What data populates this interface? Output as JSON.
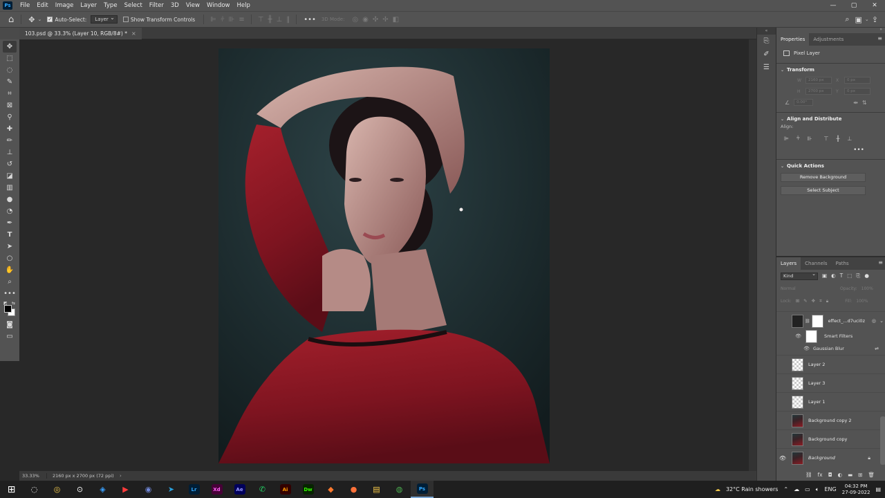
{
  "app": {
    "logo": "Ps"
  },
  "menu": [
    "File",
    "Edit",
    "Image",
    "Layer",
    "Type",
    "Select",
    "Filter",
    "3D",
    "View",
    "Window",
    "Help"
  ],
  "window_controls": {
    "minimize": "—",
    "maximize": "▢",
    "close": "✕"
  },
  "options_bar": {
    "auto_select_label": "Auto-Select:",
    "auto_select_checked": true,
    "auto_select_target": "Layer",
    "show_transform_label": "Show Transform Controls",
    "show_transform_checked": false,
    "mode_3d_label": "3D Mode:"
  },
  "document": {
    "tab_title": "103.psd @ 33.3% (Layer 10, RGB/8#) *",
    "tab_close": "×",
    "zoom": "33.33%",
    "info": "2160 px x 2700 px (72 ppi)",
    "status_arrow": "›"
  },
  "tools": [
    "move-tool",
    "marquee-tool",
    "lasso-tool",
    "quick-select-tool",
    "crop-tool",
    "frame-tool",
    "eyedropper-tool",
    "healing-brush-tool",
    "brush-tool",
    "clone-stamp-tool",
    "history-brush-tool",
    "eraser-tool",
    "gradient-tool",
    "blur-tool",
    "dodge-tool",
    "pen-tool",
    "type-tool",
    "path-select-tool",
    "shape-tool",
    "hand-tool",
    "zoom-tool",
    "edit-toolbar"
  ],
  "colors": {
    "foreground": "#000000",
    "background": "#ffffff",
    "accent": "#31a8ff"
  },
  "dock": {
    "collapse": "«"
  },
  "panel_collapse": "»",
  "properties": {
    "tabs": [
      "Properties",
      "Adjustments"
    ],
    "active_tab": 0,
    "menu_icon": "≡",
    "layer_kind": "Pixel Layer",
    "transform": {
      "title": "Transform",
      "w_label": "W",
      "w_value": "2160 px",
      "h_label": "H",
      "h_value": "2700 px",
      "x_label": "X",
      "x_value": "0 px",
      "y_label": "Y",
      "y_value": "0 px",
      "angle_value": "0.00°"
    },
    "align": {
      "title": "Align and Distribute",
      "label": "Align:",
      "more": "•••"
    },
    "quick_actions": {
      "title": "Quick Actions",
      "remove_background": "Remove Background",
      "select_subject": "Select Subject"
    }
  },
  "layers_panel": {
    "tabs": [
      "Layers",
      "Channels",
      "Paths"
    ],
    "active_tab": 0,
    "filter_kind": "Kind",
    "blend_mode": "Normal",
    "opacity_label": "Opacity:",
    "opacity_value": "100%",
    "lock_label": "Lock:",
    "fill_label": "Fill:",
    "fill_value": "100%",
    "layers": [
      {
        "name": "effect_...d7uci0z",
        "thumb": "checker",
        "visible": false,
        "italic": false,
        "smart": true
      },
      {
        "name": "Layer 2",
        "thumb": "checker",
        "visible": false,
        "italic": false
      },
      {
        "name": "Layer 3",
        "thumb": "checker",
        "visible": false,
        "italic": false
      },
      {
        "name": "Layer 1",
        "thumb": "checker",
        "visible": false,
        "italic": false
      },
      {
        "name": "Background copy 2",
        "thumb": "photo",
        "visible": false,
        "italic": false
      },
      {
        "name": "Background copy",
        "thumb": "photo",
        "visible": false,
        "italic": false
      },
      {
        "name": "Background",
        "thumb": "photo",
        "visible": true,
        "italic": true,
        "locked": true
      }
    ],
    "smart_filters_label": "Smart Filters",
    "gaussian_blur_label": "Gaussian Blur"
  },
  "taskbar": {
    "apps": [
      {
        "name": "start",
        "glyph": "⊞"
      },
      {
        "name": "search",
        "glyph": "◌"
      },
      {
        "name": "app-1",
        "glyph": "◎"
      },
      {
        "name": "app-2",
        "glyph": "⊙"
      },
      {
        "name": "app-3",
        "glyph": "◈"
      },
      {
        "name": "app-4",
        "glyph": "▶"
      },
      {
        "name": "discord",
        "glyph": "◉"
      },
      {
        "name": "telegram",
        "glyph": "➤"
      },
      {
        "name": "lightroom",
        "label": "Lr",
        "color": "#31a8ff",
        "bg": "#001e36"
      },
      {
        "name": "xd",
        "label": "Xd",
        "color": "#ff61f6",
        "bg": "#470137"
      },
      {
        "name": "after-effects",
        "label": "Ae",
        "color": "#9999ff",
        "bg": "#00005b"
      },
      {
        "name": "whatsapp",
        "glyph": "✆"
      },
      {
        "name": "illustrator",
        "label": "Ai",
        "color": "#ff9a00",
        "bg": "#330000"
      },
      {
        "name": "dreamweaver",
        "label": "Dw",
        "color": "#35fa00",
        "bg": "#072401"
      },
      {
        "name": "app-5",
        "glyph": "◆"
      },
      {
        "name": "firefox",
        "glyph": "●"
      },
      {
        "name": "file-explorer",
        "glyph": "▤"
      },
      {
        "name": "chrome",
        "glyph": "◍"
      },
      {
        "name": "photoshop",
        "label": "Ps",
        "color": "#31a8ff",
        "bg": "#001e36",
        "active": true
      }
    ],
    "weather": "32°C  Rain showers",
    "language": "ENG",
    "time": "04:32 PM",
    "date": "27-09-2022"
  }
}
